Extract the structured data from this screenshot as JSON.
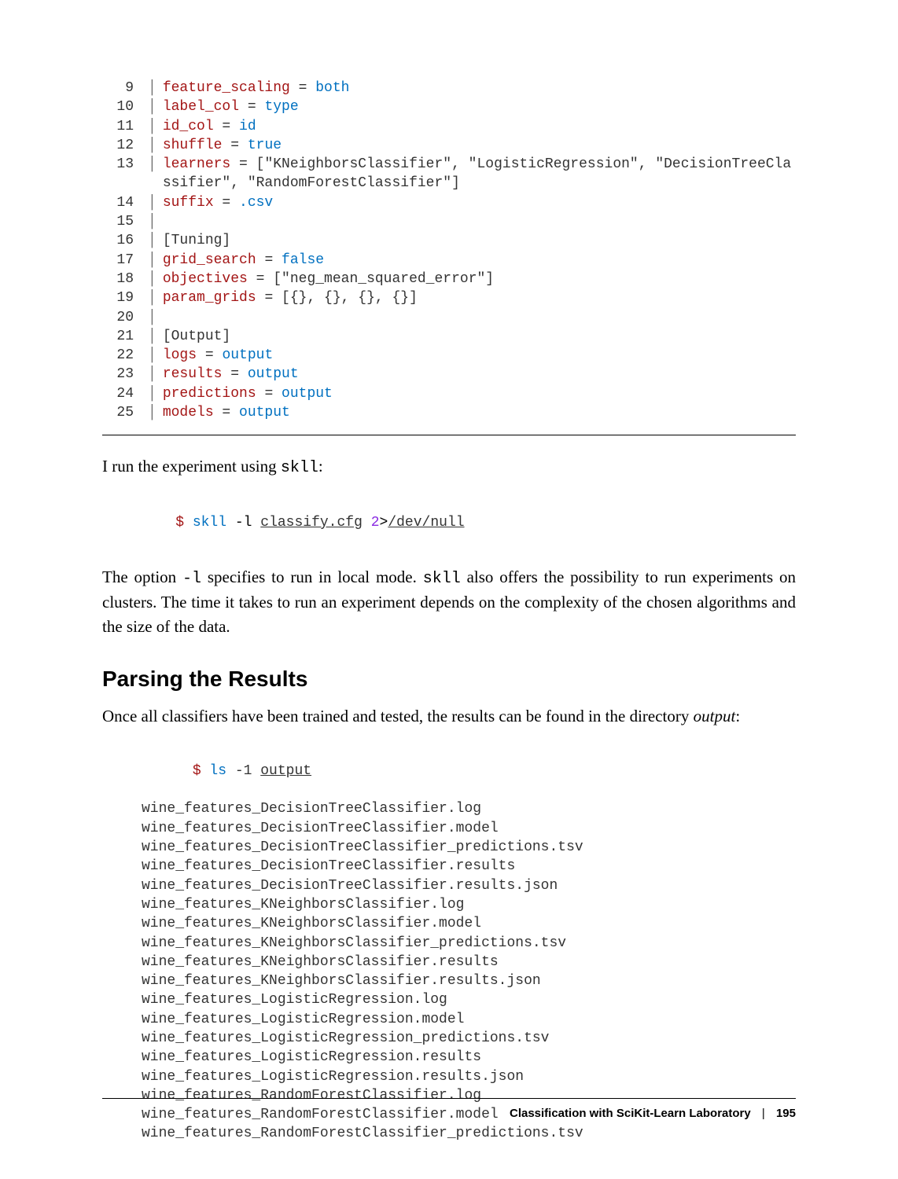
{
  "code_lines": [
    {
      "n": "9",
      "segments": [
        [
          "key",
          "feature_scaling"
        ],
        [
          "op",
          " = "
        ],
        [
          "val",
          "both"
        ]
      ]
    },
    {
      "n": "10",
      "segments": [
        [
          "key",
          "label_col"
        ],
        [
          "op",
          " = "
        ],
        [
          "val",
          "type"
        ]
      ]
    },
    {
      "n": "11",
      "segments": [
        [
          "key",
          "id_col"
        ],
        [
          "op",
          " = "
        ],
        [
          "val",
          "id"
        ]
      ]
    },
    {
      "n": "12",
      "segments": [
        [
          "key",
          "shuffle"
        ],
        [
          "op",
          " = "
        ],
        [
          "val",
          "true"
        ]
      ]
    },
    {
      "n": "13",
      "segments": [
        [
          "key",
          "learners"
        ],
        [
          "op",
          " = "
        ],
        [
          "str",
          "[\"KNeighborsClassifier\", \"LogisticRegression\", \"DecisionTreeClassifier\", \"RandomForestClassifier\"]"
        ]
      ]
    },
    {
      "n": "14",
      "segments": [
        [
          "key",
          "suffix"
        ],
        [
          "op",
          " = "
        ],
        [
          "val",
          ".csv"
        ]
      ]
    },
    {
      "n": "15",
      "segments": []
    },
    {
      "n": "16",
      "segments": [
        [
          "sec",
          "[Tuning]"
        ]
      ]
    },
    {
      "n": "17",
      "segments": [
        [
          "key",
          "grid_search"
        ],
        [
          "op",
          " = "
        ],
        [
          "val",
          "false"
        ]
      ]
    },
    {
      "n": "18",
      "segments": [
        [
          "key",
          "objectives"
        ],
        [
          "op",
          " = "
        ],
        [
          "str",
          "[\"neg_mean_squared_error\"]"
        ]
      ]
    },
    {
      "n": "19",
      "segments": [
        [
          "key",
          "param_grids"
        ],
        [
          "op",
          " = "
        ],
        [
          "str",
          "[{}, {}, {}, {}]"
        ]
      ]
    },
    {
      "n": "20",
      "segments": []
    },
    {
      "n": "21",
      "segments": [
        [
          "sec",
          "[Output]"
        ]
      ]
    },
    {
      "n": "22",
      "segments": [
        [
          "key",
          "logs"
        ],
        [
          "op",
          " = "
        ],
        [
          "val",
          "output"
        ]
      ]
    },
    {
      "n": "23",
      "segments": [
        [
          "key",
          "results"
        ],
        [
          "op",
          " = "
        ],
        [
          "val",
          "output"
        ]
      ]
    },
    {
      "n": "24",
      "segments": [
        [
          "key",
          "predictions"
        ],
        [
          "op",
          " = "
        ],
        [
          "val",
          "output"
        ]
      ]
    },
    {
      "n": "25",
      "segments": [
        [
          "key",
          "models"
        ],
        [
          "op",
          " = "
        ],
        [
          "val",
          "output"
        ]
      ]
    }
  ],
  "para1_a": "I run the experiment using ",
  "para1_mono": "skll",
  "para1_b": ":",
  "cmd1": {
    "prompt": "$ ",
    "cmd": "skll",
    "opt": " -l ",
    "arg1": "classify.cfg",
    "sp1": " ",
    "num": "2",
    "gt": ">",
    "arg2": "/dev/null"
  },
  "para2_a": "The option ",
  "para2_mono1": "-l",
  "para2_b": " specifies to run in local mode. ",
  "para2_mono2": "skll",
  "para2_c": " also offers the possibility to run experiments on clusters. The time it takes to run an experiment depends on the complexity of the chosen algorithms and the size of the data.",
  "section_heading": "Parsing the Results",
  "para3_a": "Once all classifiers have been trained and tested, the results can be found in the directory ",
  "para3_em": "output",
  "para3_b": ":",
  "cmd2": {
    "prompt": "$ ",
    "cmd": "ls",
    "opt": " -1 ",
    "arg": "output"
  },
  "output_files": [
    "wine_features_DecisionTreeClassifier.log",
    "wine_features_DecisionTreeClassifier.model",
    "wine_features_DecisionTreeClassifier_predictions.tsv",
    "wine_features_DecisionTreeClassifier.results",
    "wine_features_DecisionTreeClassifier.results.json",
    "wine_features_KNeighborsClassifier.log",
    "wine_features_KNeighborsClassifier.model",
    "wine_features_KNeighborsClassifier_predictions.tsv",
    "wine_features_KNeighborsClassifier.results",
    "wine_features_KNeighborsClassifier.results.json",
    "wine_features_LogisticRegression.log",
    "wine_features_LogisticRegression.model",
    "wine_features_LogisticRegression_predictions.tsv",
    "wine_features_LogisticRegression.results",
    "wine_features_LogisticRegression.results.json",
    "wine_features_RandomForestClassifier.log",
    "wine_features_RandomForestClassifier.model",
    "wine_features_RandomForestClassifier_predictions.tsv"
  ],
  "footer_title": "Classification with SciKit-Learn Laboratory",
  "footer_sep": "|",
  "footer_page": "195"
}
